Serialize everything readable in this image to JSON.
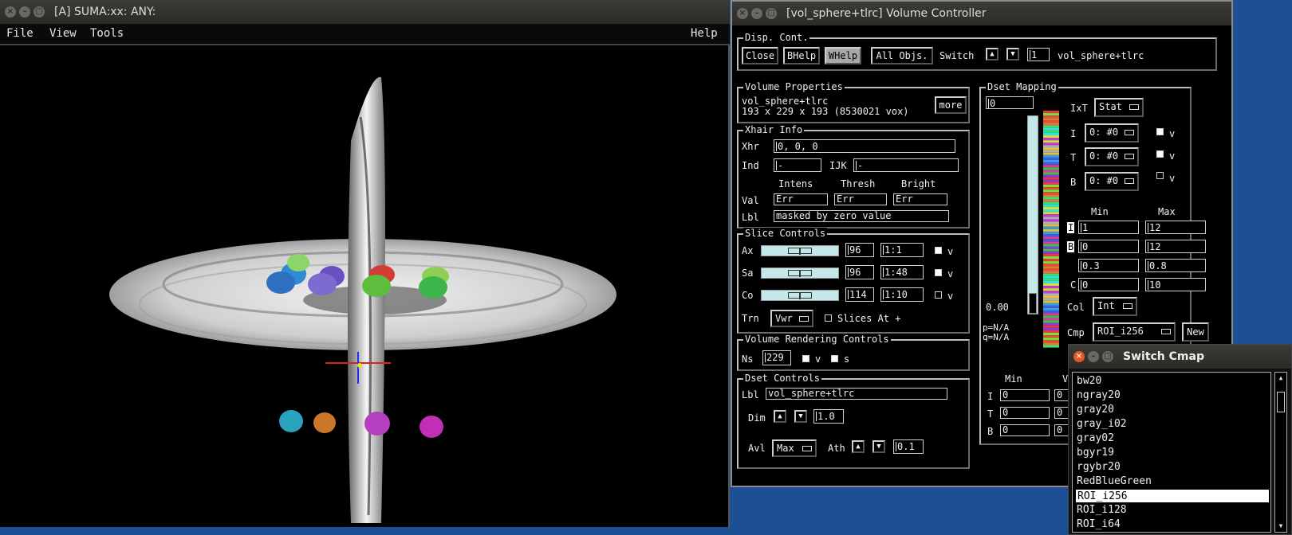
{
  "suma": {
    "title": "[A] SUMA:xx: ANY:",
    "menu": [
      "File",
      "View",
      "Tools"
    ],
    "help": "Help"
  },
  "vc": {
    "title": "[vol_sphere+tlrc] Volume Controller",
    "disp_cont": {
      "title": "Disp. Cont.",
      "close": "Close",
      "bhelp": "BHelp",
      "whelp": "WHelp",
      "all_objs": "All Objs.",
      "switch": "Switch",
      "switch_value": "1",
      "object_name": "vol_sphere+tlrc"
    },
    "volume_properties": {
      "title": "Volume Properties",
      "name": "vol_sphere+tlrc",
      "dims": "193 x 229 x 193 (8530021 vox)",
      "more": "more"
    },
    "xhair": {
      "title": "Xhair Info",
      "xhr_label": "Xhr",
      "xhr_value": "0, 0, 0",
      "ind_label": "Ind",
      "ind_value": "-",
      "ijk_label": "IJK",
      "ijk_value": "-",
      "col_intens": "Intens",
      "col_thresh": "Thresh",
      "col_bright": "Bright",
      "val_label": "Val",
      "val_intens": "Err",
      "val_thresh": "Err",
      "val_bright": "Err",
      "lbl_label": "Lbl",
      "lbl_value": "masked by zero value"
    },
    "slice_controls": {
      "title": "Slice Controls",
      "rows": [
        {
          "label": "Ax",
          "index": "96",
          "step": "1:1",
          "checked": true,
          "v": "v",
          "slider": 0.5
        },
        {
          "label": "Sa",
          "index": "96",
          "step": "1:48",
          "checked": true,
          "v": "v",
          "slider": 0.5
        },
        {
          "label": "Co",
          "index": "114",
          "step": "1:10",
          "checked": false,
          "v": "v",
          "slider": 0.5
        }
      ],
      "trn_label": "Trn",
      "trn_value": "Vwr",
      "slices_at": "Slices At +"
    },
    "volume_rendering": {
      "title": "Volume Rendering Controls",
      "ns_label": "Ns",
      "ns_value": "229",
      "v": "v",
      "s": "s"
    },
    "dset_controls": {
      "title": "Dset Controls",
      "lbl_label": "Lbl",
      "lbl_value": "vol_sphere+tlrc",
      "dim_label": "Dim",
      "dim_value": "1.0",
      "avl_label": "Avl",
      "avl_value": "Max",
      "ath_label": "Ath",
      "ath_value": "0.1"
    },
    "dset_mapping": {
      "title": "Dset Mapping",
      "top_value": "0",
      "ixt_label": "IxT",
      "ixt_value": "Stat",
      "i_label": "I",
      "i_value": "0: #0",
      "t_label": "T",
      "t_value": "0: #0",
      "b_label": "B",
      "b_value": "0: #0",
      "v": "v",
      "min_label": "Min",
      "max_label": "Max",
      "row1_tag": "I",
      "row1_min": "1",
      "row1_max": "12",
      "row2_tag": "B",
      "row2_min": "0",
      "row2_max": "12",
      "row3_min": "0.3",
      "row3_max": "0.8",
      "row4_tag": "C",
      "row4_min": "0",
      "row4_max": "10",
      "col_label": "Col",
      "col_value": "Int",
      "cmp_label": "Cmp",
      "cmp_value": "ROI_i256",
      "new": "New",
      "bar_zero": "0.00",
      "p": "p=N/A",
      "q": "q=N/A",
      "lower_min": "Min",
      "lower_v": "V",
      "lower_i": "I",
      "lower_t": "T",
      "lower_b": "B",
      "lower_i_val": "0",
      "lower_t_val": "0",
      "lower_b_val": "0",
      "lower_i_val2": "0",
      "lower_t_val2": "0",
      "lower_b_val2": "0"
    }
  },
  "switch_cmap": {
    "title": "Switch Cmap",
    "items": [
      "bw20",
      "ngray20",
      "gray20",
      "gray_i02",
      "gray02",
      "bgyr19",
      "rgybr20",
      "RedBlueGreen",
      "ROI_i256",
      "ROI_i128",
      "ROI_i64"
    ],
    "selected_index": 8
  },
  "colors": {
    "desktop": "#1c4f94",
    "titlebar": "#3c3b37",
    "close_active": "#e95420",
    "slider": "#c4e8ea"
  }
}
